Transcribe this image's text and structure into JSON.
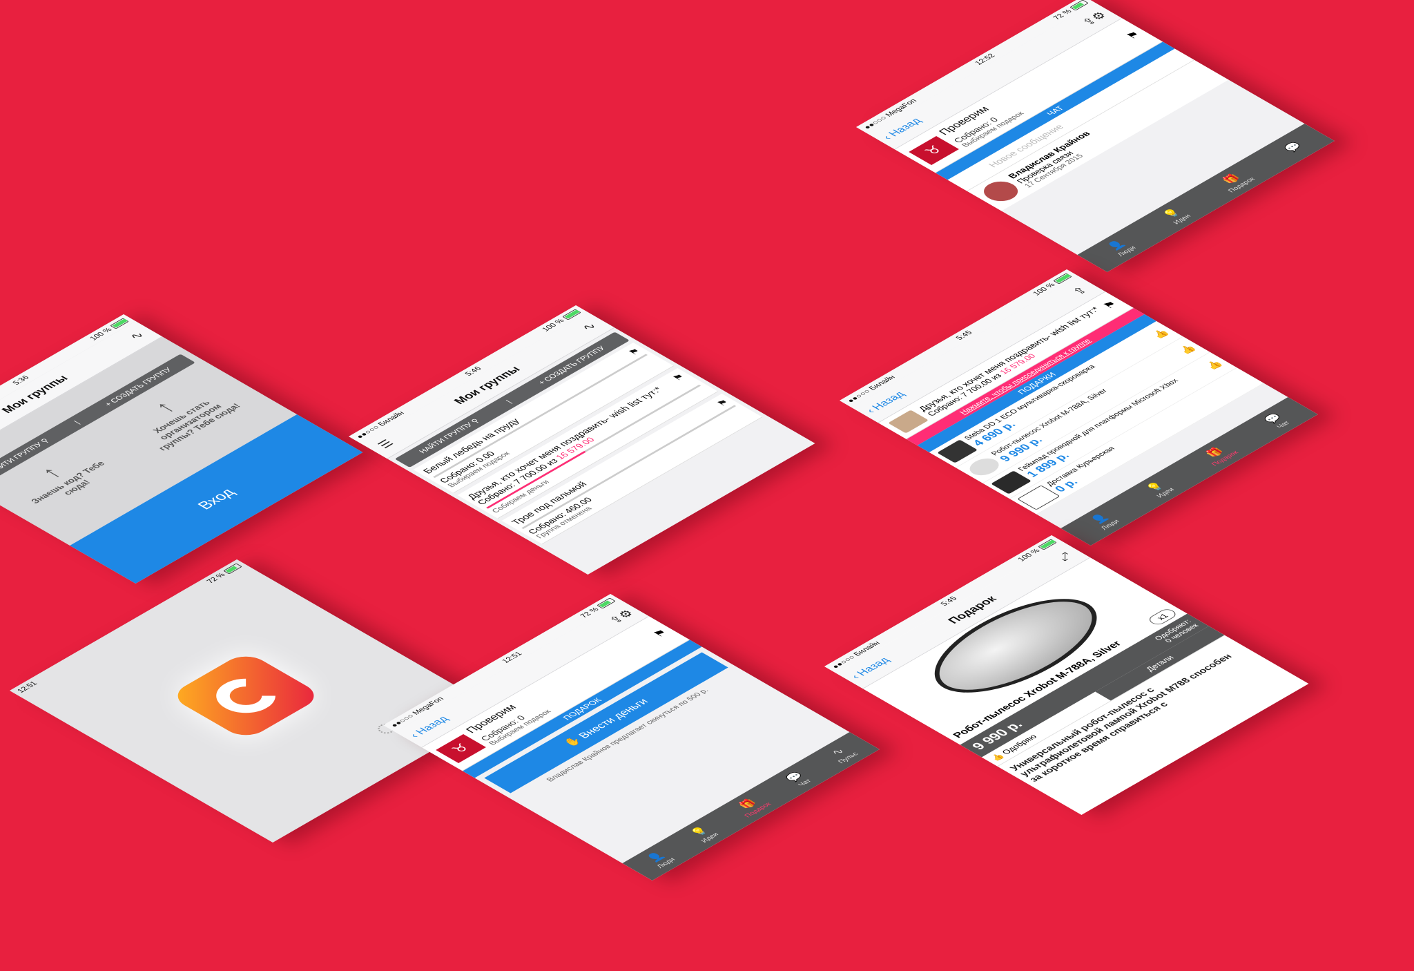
{
  "bars": {
    "carrier_megafon": "●●○○○ MegaFon",
    "carrier_beeline": "●●○○○ Билайн",
    "time_1251": "12:51",
    "time_1252": "12:52",
    "time_536": "5:36",
    "time_546": "5:46",
    "time_545": "5:45",
    "battery_72": "72 %",
    "battery_100": "100 %"
  },
  "tabs": {
    "people": "Люди",
    "ideas": "Идеи",
    "gift": "Подарок",
    "chat": "Чат",
    "pulse": "Пульс"
  },
  "nav": {
    "back": "Назад",
    "my_groups": "Мои группы",
    "gift_title": "Подарок"
  },
  "empty": {
    "find": "НАЙТИ ГРУППУ",
    "create": "СОЗДАТЬ ГРУППУ",
    "hint_left": "Знаешь код? Тебе сюда!",
    "hint_right": "Хочешь стать организатором группы? Тебе сюда!",
    "login": "Вход"
  },
  "groups": [
    {
      "name": "Белый лебедь на пруду",
      "collected": "Собрано: 0.00",
      "status": "Выбираем подарок"
    },
    {
      "name": "Друзья, кто хочет меня поздравить- wish list тут:*",
      "collected": "Собрано: 7 700.00",
      "of": "из",
      "target": "16 579.00",
      "status": "Собираем деньги",
      "progress": 0.46
    },
    {
      "name": "Трое под пальмой",
      "collected": "Собрано: 460.00",
      "status": "Группа отменена"
    }
  ],
  "group": {
    "name": "Проверим",
    "collected": "Собрано: 0",
    "status": "Выбираем подарок",
    "gifts_header": "ПОДАРОК",
    "pay_button": "Внести деньги",
    "note": "Владислав Крайнов предлагает скинуться по 500 р.",
    "chat_header": "ЧАТ",
    "new_message": "Новое сообщение",
    "msg_author": "Владислав Крайнов",
    "msg_text": "Проверка связи",
    "msg_date": "17 Сентября 2015"
  },
  "wishlist": {
    "name": "Друзья, кто хочет меня поздравить- wish list тут:*",
    "collected": "Собрано: 7 700.00",
    "of": "из",
    "target": "16 579.00",
    "join": "Нажмите, чтобы присоединиться к группе",
    "gifts_header": "ПОДАРКИ",
    "products": [
      {
        "name": "Steba DD 1 ECO мультиварка-скороварка",
        "price": "4 690 р."
      },
      {
        "name": "Робот-пылесос Xrobot M-788A, Silver",
        "price": "9 990 р."
      },
      {
        "name": "Геймпад проводной для платформы Microsoft Xbox",
        "price": "1 899 р."
      },
      {
        "name": "Доставка Курьерская",
        "price": "0 р."
      }
    ]
  },
  "product": {
    "name": "Робот-пылесос Xrobot M-788A, Silver",
    "price": "9 990 р.",
    "qty": "x1",
    "approved_label": "Одобряют:",
    "approved_value": "0 человек",
    "approve": "Одобряю",
    "details": "Детали",
    "description": "Универсальный робот-пылесос с ультрафиолетовой лампой Xrobot M788 способен за короткое время справиться с"
  },
  "colors": {
    "background": "#e8203f",
    "accent_blue": "#1e88e5",
    "accent_pink": "#ff2d75",
    "tabbar": "#555657"
  }
}
